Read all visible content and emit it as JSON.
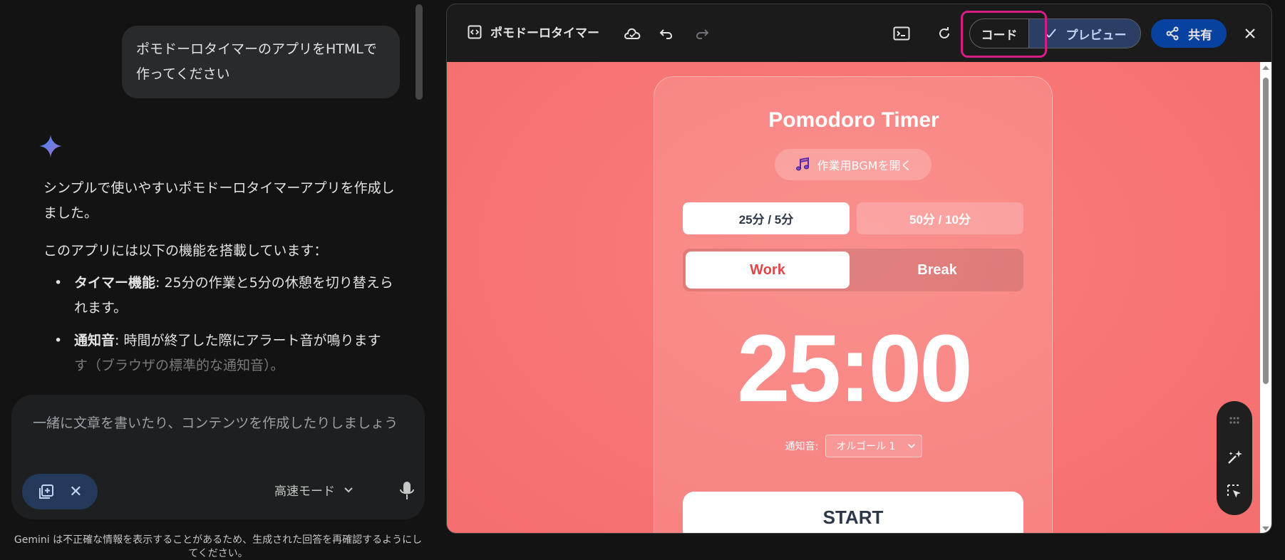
{
  "chat": {
    "user_message": "ポモドーロタイマーのアプリをHTMLで作ってください",
    "reply_intro": "シンプルで使いやすいポモドーロタイマーアプリを作成しました。",
    "reply_features_heading": "このアプリには以下の機能を搭載しています：",
    "features": [
      {
        "title": "タイマー機能",
        "text": ": 25分の作業と5分の休憩を切り替えられます。"
      },
      {
        "title": "通知音",
        "text": ": 時間が終了した際にアラート音が鳴ります",
        "tail": "す（ブラウザの標準的な通知音）。"
      }
    ],
    "composer_placeholder": "一緒に文章を書いたり、コンテンツを作成したりしましょう",
    "mode_label": "高速モード",
    "disclaimer": "Gemini は不正確な情報を表示することがあるため、生成された回答を再確認するようにしてください。"
  },
  "canvas": {
    "title": "ポモドーロタイマー",
    "code_label": "コード",
    "preview_label": "プレビュー",
    "share_label": "共有",
    "close_icon": "close-icon"
  },
  "app": {
    "title": "Pomodoro Timer",
    "bgm_label": "作業用BGMを開く",
    "presets": [
      "25分 / 5分",
      "50分 / 10分"
    ],
    "modes": [
      "Work",
      "Break"
    ],
    "time": "25:00",
    "sound_label": "通知音:",
    "sound_value": "オルゴール 1",
    "start_label": "START"
  },
  "colors": {
    "accent_highlight": "#d41d86",
    "preview_bg": "#f77472",
    "share_bg": "#0842a0",
    "work_text": "#e04848"
  }
}
